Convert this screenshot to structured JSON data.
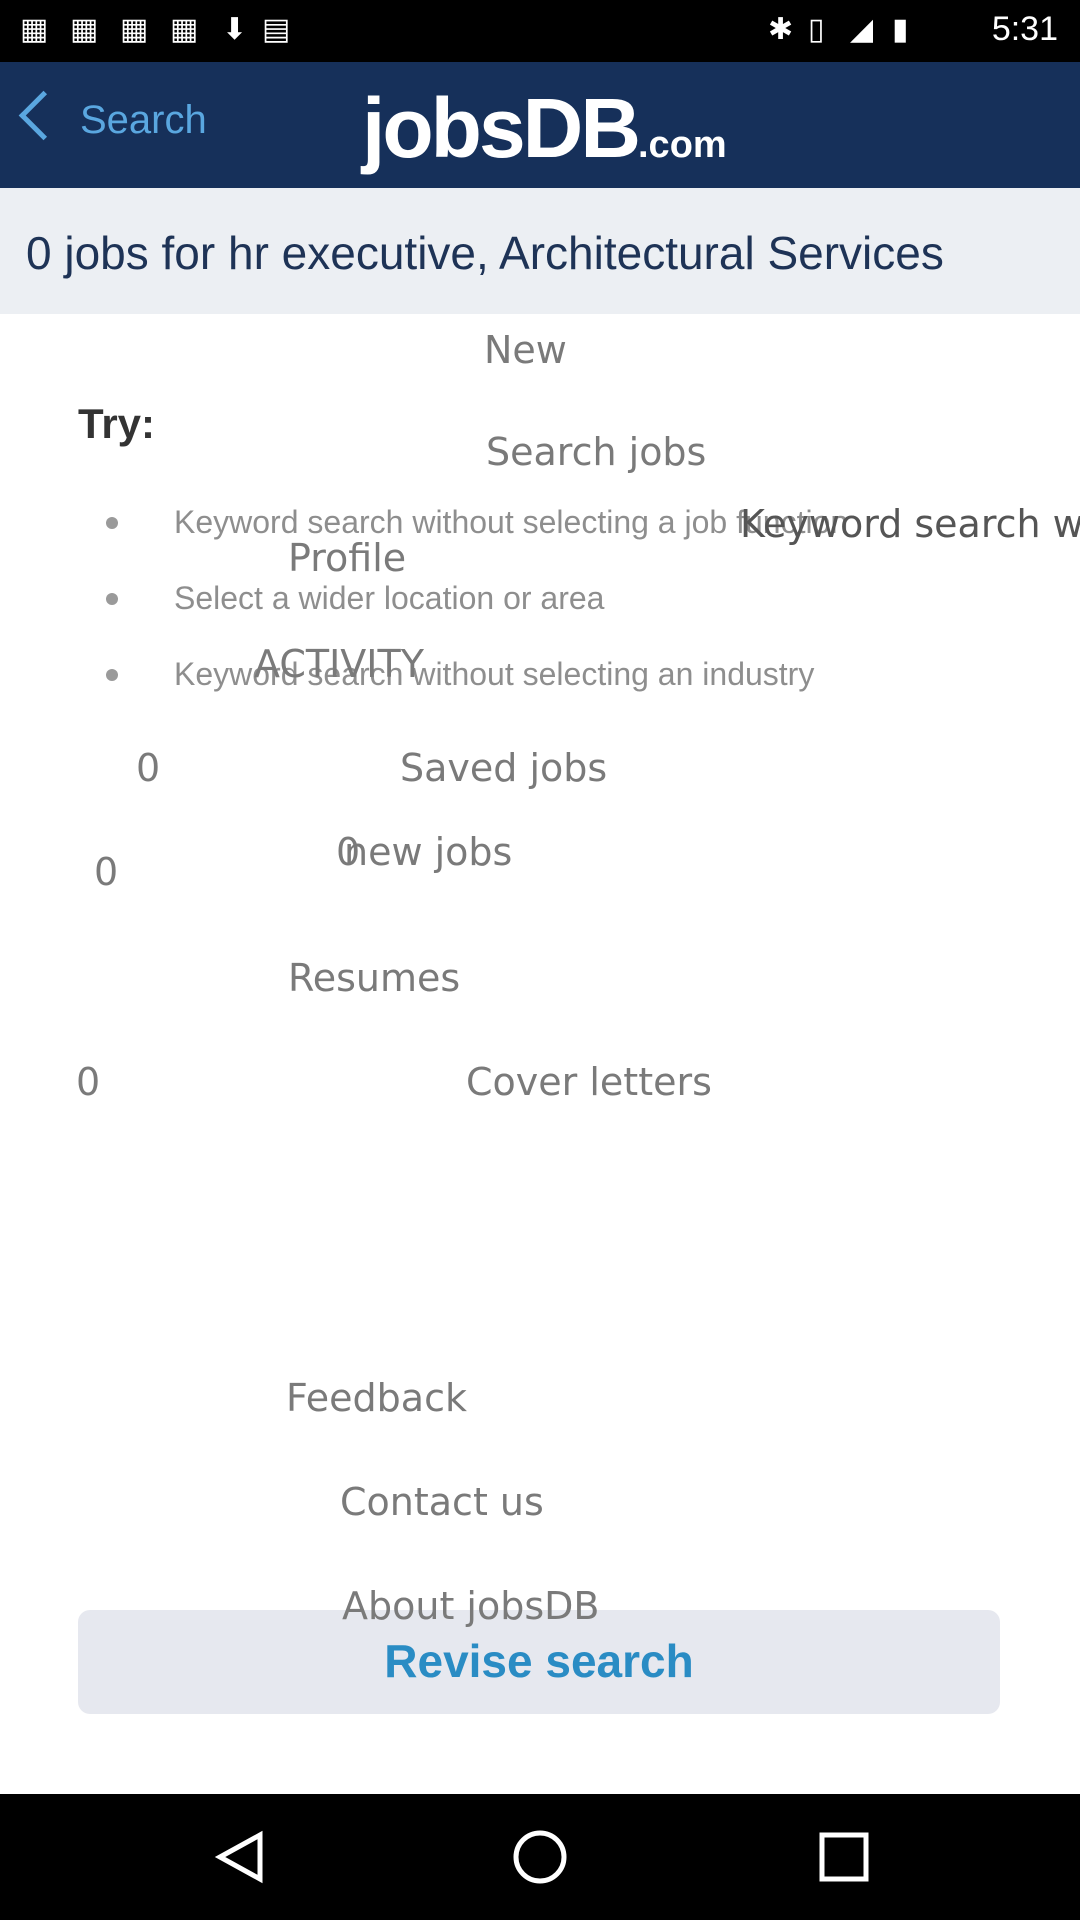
{
  "status_bar": {
    "time": "5:31"
  },
  "header": {
    "back_label": "Search",
    "logo_main": "jobsDB",
    "logo_suffix": ".com"
  },
  "results": {
    "summary": "0 jobs for hr executive, Architectural Services"
  },
  "try": {
    "label": "Try:",
    "tips": [
      "Keyword search without selecting a job function",
      "Select a wider location or area",
      "Keyword search without selecting an industry"
    ]
  },
  "overlay_menu": {
    "new_label": "New",
    "search_jobs": "Search jobs",
    "keyword_search_fragment": "Keyword search w",
    "profile": "Profile",
    "activity": "ACTIVITY",
    "saved_jobs": {
      "count": "0",
      "label": "Saved jobs"
    },
    "new_jobs": {
      "count": "0",
      "label": "new jobs",
      "count_overlap": "0"
    },
    "resumes": "Resumes",
    "cover_letters": {
      "count": "0",
      "label": "Cover letters"
    },
    "feedback": "Feedback",
    "contact_us": "Contact us",
    "about": "About jobsDB"
  },
  "actions": {
    "revise_search": "Revise search"
  },
  "colors": {
    "header_bg": "#16305a",
    "accent": "#5aa7e0",
    "button_text": "#2a8cc4",
    "banner_bg": "#eceff3"
  }
}
